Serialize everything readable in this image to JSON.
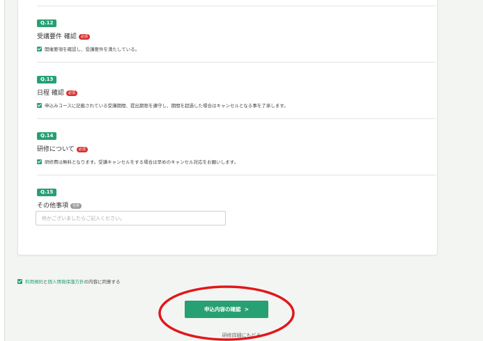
{
  "questions": [
    {
      "number": "Q.12",
      "title": "受講要件 確認",
      "tag": "必須",
      "check_text": "開催要項を確認し、受講要件を満たしている。"
    },
    {
      "number": "Q.13",
      "title": "日程 確認",
      "tag": "必須",
      "check_text": "申込みコースに記載されている受講期間、提出期限を遵守し、期間を超過した場合はキャンセルとなる事を了承します。"
    },
    {
      "number": "Q.14",
      "title": "研修について",
      "tag": "必須",
      "check_text": "研修費は無料となります。受講キャンセルをする場合は早めのキャンセル対応をお願いします。"
    }
  ],
  "other": {
    "number": "Q.15",
    "title": "その他事項",
    "tag": "任意",
    "placeholder": "何かございましたらご記入ください。",
    "value": ""
  },
  "agreement": {
    "terms_link": "利用規約",
    "and": "と",
    "privacy_link": "個人情報保護方針",
    "suffix": "の内容に同意する"
  },
  "confirm_button": {
    "label": "申込内容の確認",
    "arrow": ">"
  },
  "back_link": "研修詳細にもどる",
  "colors": {
    "accent": "#27a073",
    "required": "#d83030",
    "optional": "#9a9a9a",
    "highlight_ring": "#e3161b"
  }
}
